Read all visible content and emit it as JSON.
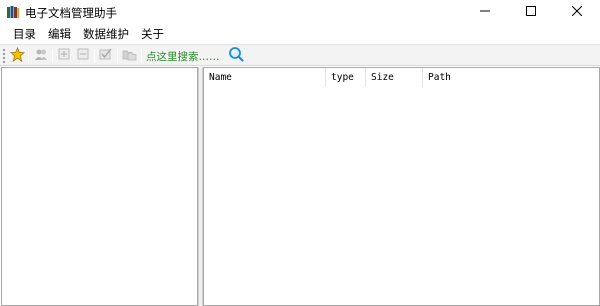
{
  "window": {
    "title": "电子文档管理助手",
    "controls": [
      "minimize-icon",
      "maximize-icon",
      "close-icon"
    ]
  },
  "menu": {
    "items": [
      {
        "label": "目录"
      },
      {
        "label": "编辑"
      },
      {
        "label": "数据维护"
      },
      {
        "label": "关于"
      }
    ]
  },
  "toolbar": {
    "buttons": [
      {
        "icon": "star-icon",
        "enabled": true
      },
      {
        "icon": "people-icon",
        "enabled": false
      },
      {
        "icon": "add-icon",
        "enabled": false
      },
      {
        "icon": "remove-icon",
        "enabled": false
      },
      {
        "icon": "check-edit-icon",
        "enabled": false
      },
      {
        "icon": "folder-move-icon",
        "enabled": false
      }
    ],
    "search_link": "点这里搜索……",
    "search_icon": "magnifier-icon"
  },
  "file_list": {
    "columns": [
      {
        "label": "Name"
      },
      {
        "label": "type"
      },
      {
        "label": "Size"
      },
      {
        "label": "Path"
      }
    ],
    "rows": []
  },
  "colors": {
    "accent_star": "#f5b800",
    "search_link": "#2a8a2a",
    "search_icon": "#1e8fd6"
  }
}
